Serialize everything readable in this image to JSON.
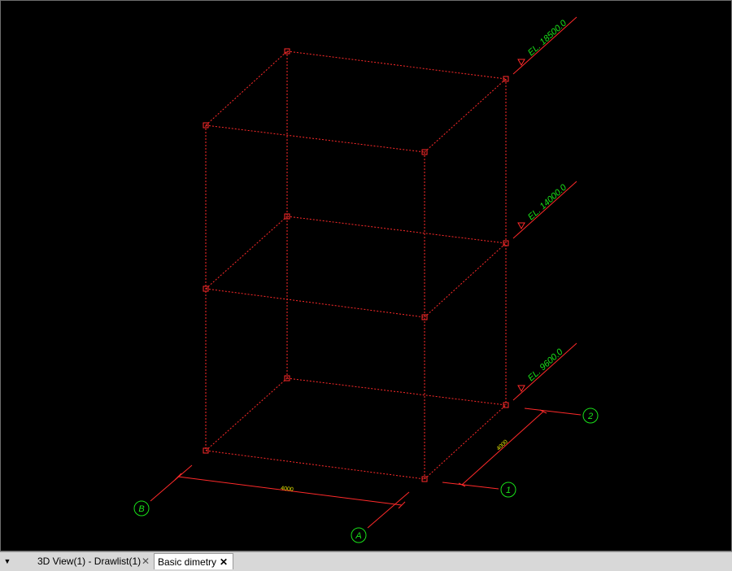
{
  "viewport": {
    "background": "#000000",
    "member_color": "#ff2a2a",
    "label_color": "#19e019",
    "dimension_text_color": "#e6e600"
  },
  "elevations": [
    {
      "label": "EL. 18500.0"
    },
    {
      "label": "EL. 14000.0"
    },
    {
      "label": "EL. 9600.0"
    }
  ],
  "grid_bubbles": {
    "b": "B",
    "a": "A",
    "one": "1",
    "two": "2"
  },
  "dimensions": {
    "front": "4000",
    "side": "4000"
  },
  "tabs": {
    "menu_icon": "▼",
    "items": [
      {
        "label": "3D View(1) - Drawlist(1)",
        "close": "✕",
        "active": false
      },
      {
        "label": "Basic dimetry",
        "close": "✕",
        "active": true
      }
    ]
  }
}
